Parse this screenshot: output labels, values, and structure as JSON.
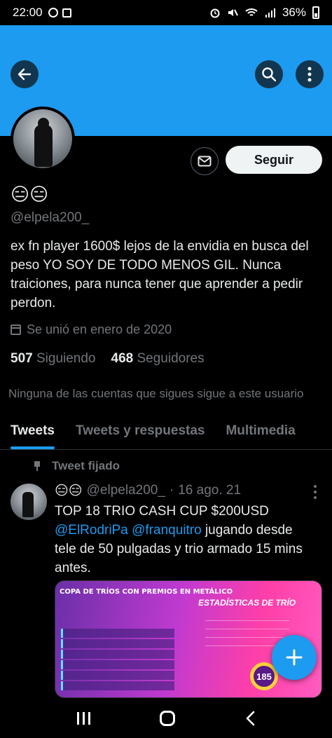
{
  "status_bar": {
    "time": "22:00",
    "battery": "36%"
  },
  "header": {
    "back_icon": "arrow-left-icon",
    "search_icon": "search-icon",
    "more_icon": "more-vertical-icon"
  },
  "profile": {
    "display_name": "😑😑",
    "handle": "@elpela200_",
    "follow_label": "Seguir",
    "bio": "ex fn player 1600$ lejos de la envidia en busca del peso YO SOY DE TODO MENOS GIL. Nunca traiciones, para nunca tener que aprender a pedir perdon.",
    "joined": "Se unió en enero de 2020",
    "following_count": "507",
    "following_label": "Siguiendo",
    "followers_count": "468",
    "followers_label": "Seguidores",
    "no_mutuals": "Ninguna de las cuentas que sigues sigue a este usuario"
  },
  "tabs": [
    {
      "label": "Tweets",
      "active": true
    },
    {
      "label": "Tweets y respuestas",
      "active": false
    },
    {
      "label": "Multimedia",
      "active": false
    }
  ],
  "tweet": {
    "pinned_label": "Tweet fijado",
    "name": "😑😑",
    "handle": "@elpela200_",
    "sep": "·",
    "date": "16 ago. 21",
    "text_line1": "TOP 18 TRIO CASH CUP $200USD",
    "mention1": "@ElRodriPa",
    "mention2": "@franquitro",
    "text_rest1": " jugando desde",
    "text_rest2": "tele de 50 pulgadas y trio armado 15 mins antes.",
    "media_title": "COPA DE TRÍOS CON PREMIOS EN METÁLICO",
    "media_subtitle": "ESTADÍSTICAS DE TRÍO",
    "media_value": "185"
  },
  "colors": {
    "accent": "#1d9bf0",
    "background": "#000000",
    "muted": "#71767b"
  }
}
